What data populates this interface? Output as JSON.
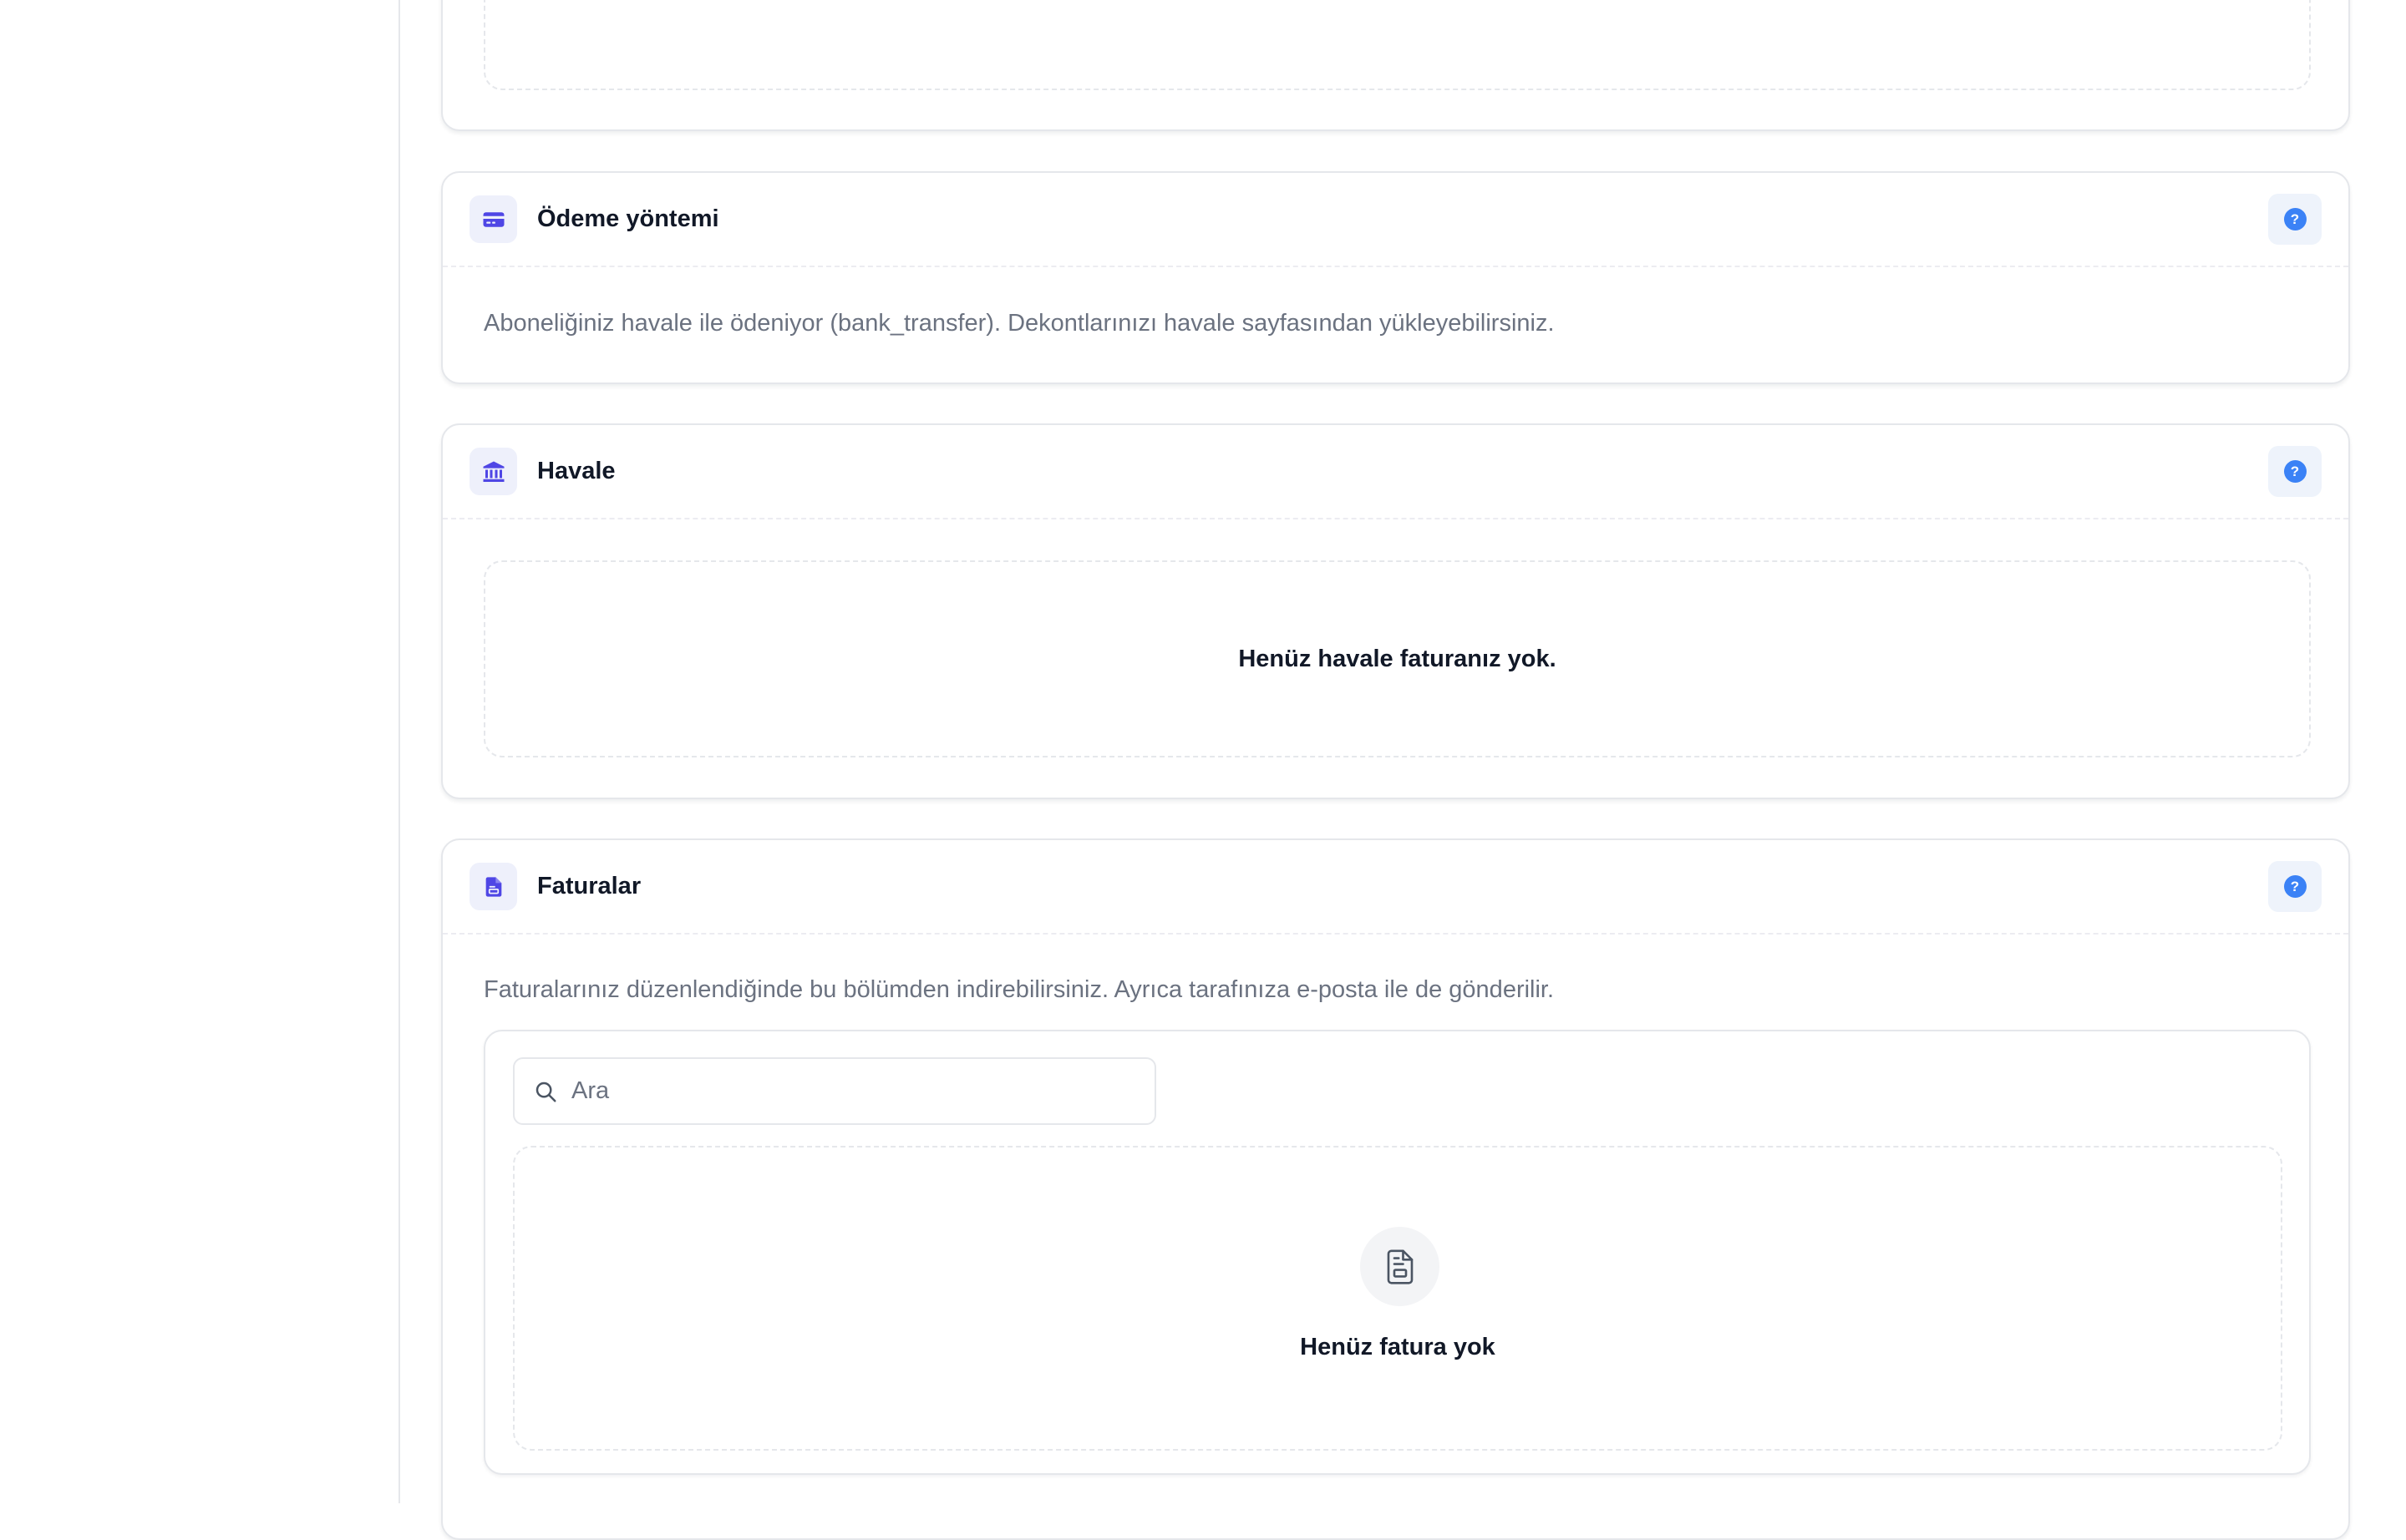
{
  "icons": {
    "payment": "credit-card-icon",
    "transfer": "bank-icon",
    "invoices": "document-icon",
    "help": "question-circle-icon",
    "search": "search-icon",
    "empty_invoices": "document-outline-icon"
  },
  "colors": {
    "accent": "#4f46e5",
    "help_blue": "#3b82f6",
    "muted_text": "#6b7280",
    "border": "#e5e7eb"
  },
  "help_label": "?",
  "payment_method": {
    "title": "Ödeme yöntemi",
    "description": "Aboneliğiniz havale ile ödeniyor (bank_transfer). Dekontlarınızı havale sayfasından yükleyebilirsiniz."
  },
  "bank_transfer": {
    "title": "Havale",
    "empty_message": "Henüz havale faturanız yok."
  },
  "invoices": {
    "title": "Faturalar",
    "description": "Faturalarınız düzenlendiğinde bu bölümden indirebilirsiniz. Ayrıca tarafınıza e-posta ile de gönderilir.",
    "search_placeholder": "Ara",
    "search_value": "",
    "empty_message": "Henüz fatura yok"
  }
}
